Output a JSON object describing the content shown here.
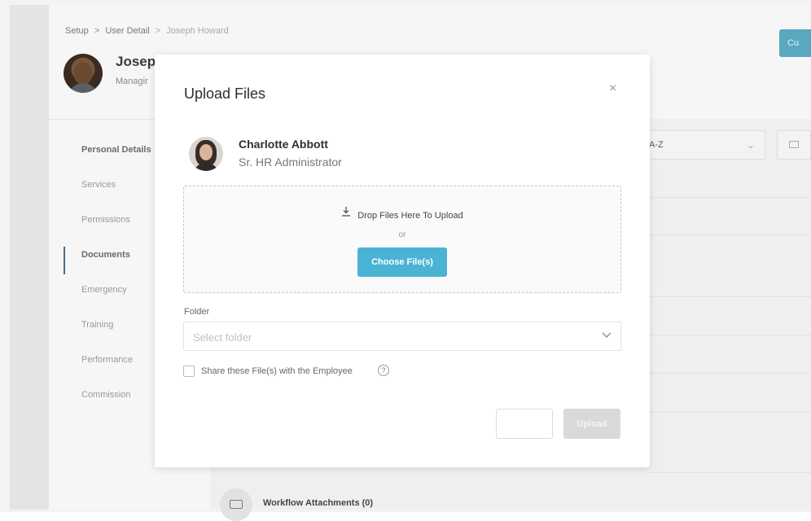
{
  "breadcrumb": {
    "items": [
      "Setup",
      "User Detail",
      "Joseph Howard"
    ],
    "separator": ">"
  },
  "user": {
    "name": "Josep",
    "title": "Managir"
  },
  "header": {
    "action_label": "Cu"
  },
  "sidebar": {
    "items": [
      {
        "label": "Personal Details"
      },
      {
        "label": "Services"
      },
      {
        "label": "Permissions"
      },
      {
        "label": "Documents"
      },
      {
        "label": "Emergency"
      },
      {
        "label": "Training"
      },
      {
        "label": "Performance"
      },
      {
        "label": "Commission"
      }
    ],
    "active_index": 3
  },
  "toolbar": {
    "sort_label": "A-Z"
  },
  "documents": {
    "workflow_label": "Workflow Attachments (0)"
  },
  "modal": {
    "title": "Upload Files",
    "close_symbol": "×",
    "uploader": {
      "name": "Charlotte Abbott",
      "role": "Sr. HR Administrator"
    },
    "dropzone": {
      "text": "Drop Files Here To Upload",
      "or_text": "or",
      "choose_label": "Choose File(s)"
    },
    "folder": {
      "label": "Folder",
      "placeholder": "Select folder"
    },
    "share": {
      "label": "Share these File(s) with the Employee",
      "help_symbol": "?",
      "checked": false
    },
    "buttons": {
      "cancel_label": "",
      "upload_label": "Upload"
    }
  },
  "colors": {
    "accent": "#4ab3d4",
    "upload_disabled": "#d9d9d9",
    "active_nav": "#4a6a8a"
  }
}
